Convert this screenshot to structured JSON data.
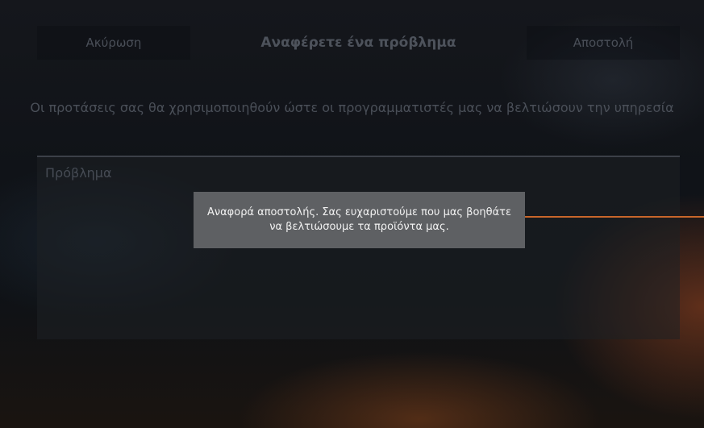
{
  "header": {
    "cancel_label": "Ακύρωση",
    "title": "Αναφέρετε ένα πρόβλημα",
    "send_label": "Αποστολή"
  },
  "subtitle": "Οι προτάσεις σας θα χρησιμοποιηθούν ώστε οι προγραμματιστές μας να βελτιώσουν την υπηρεσία",
  "form": {
    "problem_placeholder": "Πρόβλημα"
  },
  "toast": {
    "message": "Αναφορά αποστολής. Σας ευχαριστούμε που μας βοηθάτε να βελτιώσουμε τα προϊόντα μας."
  },
  "colors": {
    "accent": "#c8662a",
    "toast_bg": "#5e6063"
  }
}
